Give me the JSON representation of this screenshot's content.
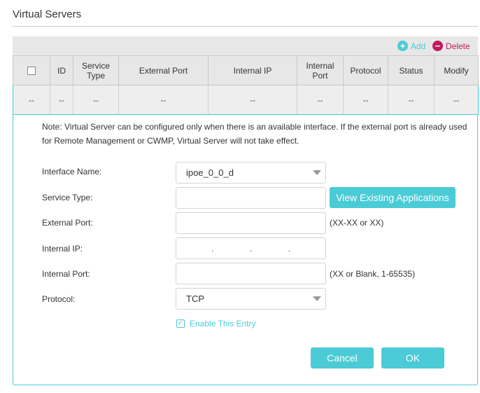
{
  "section_title": "Virtual Servers",
  "toolbar": {
    "add_label": "Add",
    "delete_label": "Delete",
    "add_icon": "plus-circle-icon",
    "delete_icon": "minus-circle-icon"
  },
  "table": {
    "columns": [
      "ID",
      "Service Type",
      "External Port",
      "Internal IP",
      "Internal Port",
      "Protocol",
      "Status",
      "Modify"
    ],
    "row": [
      "--",
      "--",
      "--",
      "--",
      "--",
      "--",
      "--",
      "--",
      "--"
    ]
  },
  "note": "Note: Virtual Server can be configured only when there is an available interface. If the external port is already used for Remote Management or CWMP, Virtual Server will not take effect.",
  "form": {
    "interface_label": "Interface Name:",
    "interface_value": "ipoe_0_0_d",
    "service_type_label": "Service Type:",
    "service_type_value": "",
    "view_apps_label": "View Existing Applications",
    "external_port_label": "External Port:",
    "external_port_value": "",
    "external_port_hint": "(XX-XX or XX)",
    "internal_ip_label": "Internal IP:",
    "internal_ip_separator": ".",
    "internal_port_label": "Internal Port:",
    "internal_port_value": "",
    "internal_port_hint": "(XX or Blank, 1-65535)",
    "protocol_label": "Protocol:",
    "protocol_value": "TCP",
    "enable_label": "Enable This Entry",
    "enable_checked": true
  },
  "actions": {
    "cancel_label": "Cancel",
    "ok_label": "OK"
  },
  "colors": {
    "accent": "#4acbd6",
    "delete": "#c21a5c",
    "header_bg": "#e7e7e7"
  }
}
